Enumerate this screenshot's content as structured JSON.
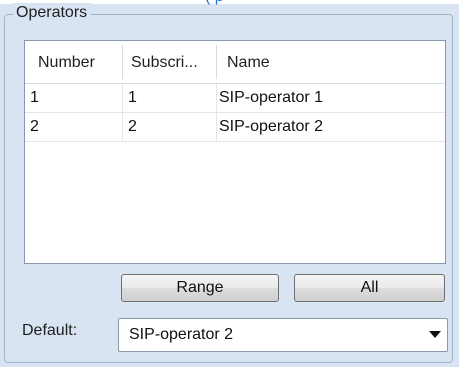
{
  "group": {
    "title": "Operators"
  },
  "operators_table": {
    "columns": [
      "Number",
      "Subscri...",
      "Name"
    ],
    "rows": [
      [
        "1",
        "1",
        "SIP-operator 1"
      ],
      [
        "2",
        "2",
        "SIP-operator 2"
      ]
    ]
  },
  "buttons": {
    "range_label": "Range",
    "all_label": "All"
  },
  "default": {
    "label": "Default:",
    "selected": "SIP-operator 2"
  },
  "icons": {
    "dropdown": "chevron-down-icon"
  },
  "colors": {
    "background": "#d9e4f3",
    "partial_link_text": "#1e6fd9"
  },
  "partial_text": "(   p"
}
